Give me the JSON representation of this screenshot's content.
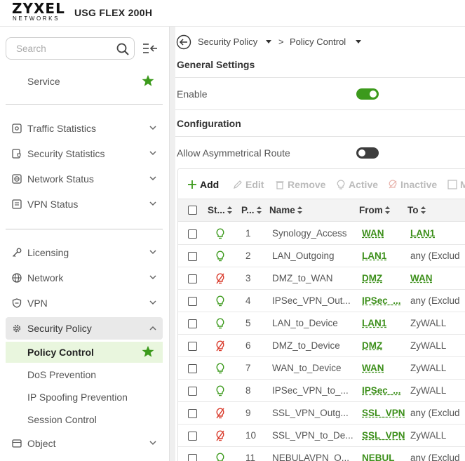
{
  "brand": {
    "logo_main": "ZYXEL",
    "logo_sub": "NETWORKS",
    "model": "USG FLEX 200H"
  },
  "sidebar": {
    "search_placeholder": "Search",
    "favorite": {
      "label": "Service"
    },
    "monitor_items": [
      {
        "label": "Traffic Statistics",
        "icon": "gear-chart-icon"
      },
      {
        "label": "Security Statistics",
        "icon": "shield-chart-icon"
      },
      {
        "label": "Network Status",
        "icon": "globe-icon"
      },
      {
        "label": "VPN Status",
        "icon": "document-icon"
      }
    ],
    "config_items": [
      {
        "label": "Licensing",
        "icon": "key-icon"
      },
      {
        "label": "Network",
        "icon": "globe-icon"
      },
      {
        "label": "VPN",
        "icon": "shield-icon"
      },
      {
        "label": "Security Policy",
        "icon": "gear-icon",
        "expanded": true
      }
    ],
    "sub_items": [
      {
        "label": "Policy Control",
        "selected": true
      },
      {
        "label": "DoS Prevention"
      },
      {
        "label": "IP Spoofing Prevention"
      },
      {
        "label": "Session Control"
      }
    ],
    "object_item": {
      "label": "Object"
    }
  },
  "breadcrumb": {
    "parent": "Security Policy",
    "separator": ">",
    "current": "Policy Control"
  },
  "general": {
    "title": "General Settings",
    "enable_label": "Enable",
    "enable_on": true
  },
  "configuration": {
    "title": "Configuration",
    "asym_label": "Allow Asymmetrical Route",
    "asym_on": false
  },
  "toolbar": {
    "add": "Add",
    "edit": "Edit",
    "remove": "Remove",
    "active": "Active",
    "inactive": "Inactive",
    "more": "M"
  },
  "table": {
    "headers": {
      "status": "St...",
      "priority": "P...",
      "name": "Name",
      "from": "From",
      "to": "To"
    },
    "rows": [
      {
        "active": true,
        "priority": "1",
        "name": "Synology_Access",
        "from": "WAN",
        "to": "LAN1",
        "to_link": true
      },
      {
        "active": true,
        "priority": "2",
        "name": "LAN_Outgoing",
        "from": "LAN1",
        "to": "any (Exclud",
        "to_link": false
      },
      {
        "active": false,
        "priority": "3",
        "name": "DMZ_to_WAN",
        "from": "DMZ",
        "to": "WAN",
        "to_link": true
      },
      {
        "active": true,
        "priority": "4",
        "name": "IPSec_VPN_Out...",
        "from": "IPSec_...",
        "to": "any (Exclud",
        "to_link": false
      },
      {
        "active": true,
        "priority": "5",
        "name": "LAN_to_Device",
        "from": "LAN1",
        "to": "ZyWALL",
        "to_link": false
      },
      {
        "active": false,
        "priority": "6",
        "name": "DMZ_to_Device",
        "from": "DMZ",
        "to": "ZyWALL",
        "to_link": false
      },
      {
        "active": true,
        "priority": "7",
        "name": "WAN_to_Device",
        "from": "WAN",
        "to": "ZyWALL",
        "to_link": false
      },
      {
        "active": true,
        "priority": "8",
        "name": "IPSec_VPN_to_...",
        "from": "IPSec_...",
        "to": "ZyWALL",
        "to_link": false
      },
      {
        "active": false,
        "priority": "9",
        "name": "SSL_VPN_Outg...",
        "from": "SSL_VPN",
        "to": "any (Exclud",
        "to_link": false
      },
      {
        "active": false,
        "priority": "10",
        "name": "SSL_VPN_to_De...",
        "from": "SSL_VPN",
        "to": "ZyWALL",
        "to_link": false
      },
      {
        "active": true,
        "priority": "11",
        "name": "NEBULAVPN_O...",
        "from": "NEBUL",
        "to": "any (Exclud",
        "to_link": false
      }
    ]
  },
  "colors": {
    "accent_green": "#3c9a1c",
    "inactive_red": "#d93a2b",
    "toggle_off": "#3d3d3d"
  }
}
